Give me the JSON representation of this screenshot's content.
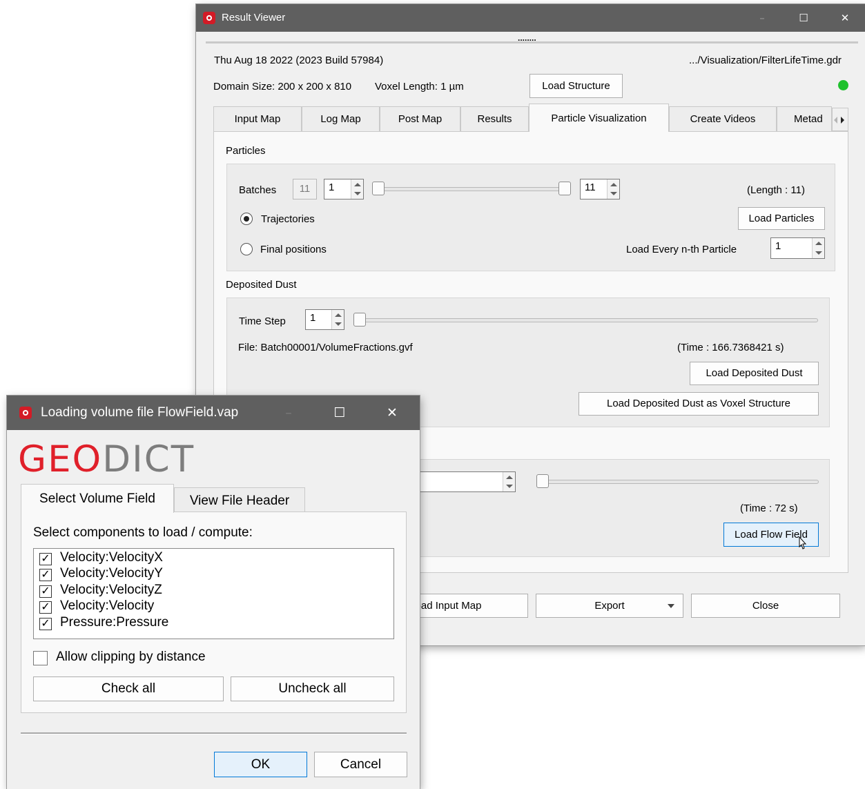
{
  "result_viewer": {
    "title": "Result Viewer",
    "buttons": {
      "minimize": "–",
      "maximize": "☐",
      "close": "✕"
    },
    "grip": "........",
    "date_build": "Thu Aug 18 2022 (2023 Build 57984)",
    "file_path": ".../Visualization/FilterLifeTime.gdr",
    "domain_size": "Domain Size: 200 x 200 x 810",
    "voxel_length": "Voxel Length: 1 µm",
    "load_structure": "Load Structure",
    "status_color": "#1fc12d",
    "tabs": [
      "Input Map",
      "Log Map",
      "Post Map",
      "Results",
      "Particle Visualization",
      "Create Videos",
      "Metad"
    ],
    "active_tab": "Particle Visualization",
    "particles": {
      "heading": "Particles",
      "batches_label": "Batches",
      "batches_total": "11",
      "batches_from": "1",
      "batches_to": "11",
      "length": "(Length : 11)",
      "trajectories": "Trajectories",
      "final_positions": "Final positions",
      "selected_mode": "Trajectories",
      "load_particles": "Load Particles",
      "load_every": "Load Every n-th Particle",
      "load_every_value": "1"
    },
    "deposited_dust": {
      "heading": "Deposited Dust",
      "time_step_label": "Time Step",
      "time_step_value": "1",
      "file": "File: Batch00001/VolumeFractions.gvf",
      "time": "(Time : 166.7368421 s)",
      "load_button": "Load Deposited Dust",
      "load_voxel_button": "Load Deposited Dust as Voxel Structure"
    },
    "flow_field": {
      "time": "(Time : 72 s)",
      "load_button": "Load Flow Field"
    },
    "bottom": {
      "load_input_map": "oad Input Map",
      "export": "Export",
      "close": "Close"
    }
  },
  "loading_dialog": {
    "title": "Loading volume file FlowField.vap",
    "buttons": {
      "minimize": "–",
      "maximize": "☐",
      "close": "✕"
    },
    "logo": {
      "part1": "GEO",
      "part2": "DICT"
    },
    "tabs": [
      "Select Volume Field",
      "View File Header"
    ],
    "prompt": "Select components to load / compute:",
    "components": [
      {
        "label": "Velocity:VelocityX",
        "checked": true
      },
      {
        "label": "Velocity:VelocityY",
        "checked": true
      },
      {
        "label": "Velocity:VelocityZ",
        "checked": true
      },
      {
        "label": "Velocity:Velocity",
        "checked": true
      },
      {
        "label": "Pressure:Pressure",
        "checked": true
      }
    ],
    "allow_clipping": "Allow clipping by distance",
    "check_all": "Check all",
    "uncheck_all": "Uncheck all",
    "ok": "OK",
    "cancel": "Cancel",
    "check_mark": "✓"
  }
}
